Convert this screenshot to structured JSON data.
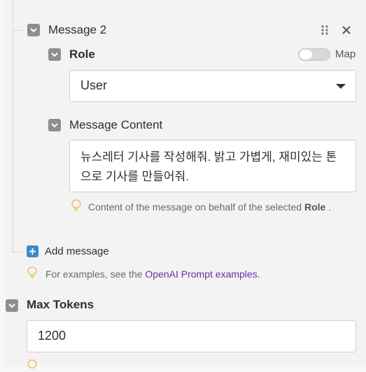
{
  "message": {
    "title": "Message 2",
    "role": {
      "label": "Role",
      "map_label": "Map",
      "map_enabled": false,
      "selected": "User"
    },
    "content": {
      "label": "Message Content",
      "value": "뉴스레터 기사를 작성해줘. 밝고 가볍게, 재미있는 톤으로 기사를 만들어줘.",
      "hint_prefix": "Content of the message on behalf of the selected ",
      "hint_bold": "Role",
      "hint_suffix": " ."
    }
  },
  "add_message": {
    "label": "Add message",
    "hint_prefix": "For examples, see the ",
    "hint_link": "OpenAI Prompt examples",
    "hint_suffix": "."
  },
  "max_tokens": {
    "label": "Max Tokens",
    "value": "1200"
  },
  "icons": {
    "check": "checkmark-icon",
    "drag": "drag-handle-icon",
    "close": "close-icon",
    "dropdown": "caret-down-icon",
    "hint": "lightbulb-icon",
    "add": "plus-icon"
  },
  "colors": {
    "checkbox": "#8e8e8e",
    "link": "#6b2fa3",
    "add_button": "#3d8ac7",
    "bulb": "#f0c35a"
  }
}
